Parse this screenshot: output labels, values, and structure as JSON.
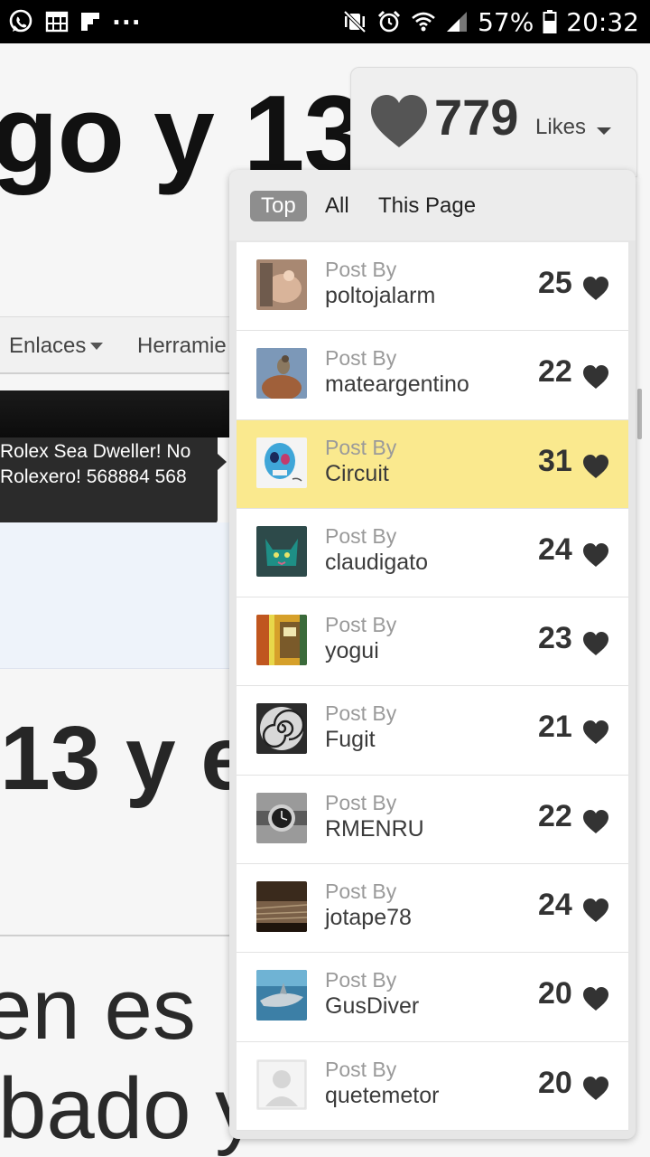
{
  "status_bar": {
    "left_icons": [
      "whatsapp-icon",
      "calendar-grid-icon",
      "flipboard-icon"
    ],
    "more": "...",
    "right_icons": [
      "mute-vibrate-icon",
      "alarm-icon",
      "wifi-icon",
      "signal-icon",
      "battery-icon"
    ],
    "battery": "57%",
    "time": "20:32",
    "colors": {
      "bar": "#000000",
      "icons": "#ffffff"
    }
  },
  "background_page": {
    "heading_top": "go y 13",
    "nav": {
      "item1": "Enlaces",
      "item2": "Herramie"
    },
    "tooltip": {
      "line1": "Rolex Sea Dweller! No",
      "line2": "Rolexero! 568884 568"
    },
    "heading_mid": "13 y e",
    "text_line1": "en es",
    "text_line2": "bado y"
  },
  "likes": {
    "count": "779",
    "label": "Likes",
    "heart_color": "#555555"
  },
  "tabs": [
    {
      "label": "Top",
      "active": true
    },
    {
      "label": "All",
      "active": false
    },
    {
      "label": "This Page",
      "active": false
    }
  ],
  "entries": [
    {
      "prefix": "Post By",
      "user": "poltojalarm",
      "count": "25",
      "avatar": "avatar-hand-icon"
    },
    {
      "prefix": "Post By",
      "user": "mateargentino",
      "count": "22",
      "avatar": "avatar-bird-icon"
    },
    {
      "prefix": "Post By",
      "user": "Circuit",
      "count": "31",
      "avatar": "avatar-skull-art-icon",
      "highlight": true
    },
    {
      "prefix": "Post By",
      "user": "claudigato",
      "count": "24",
      "avatar": "avatar-cat-icon"
    },
    {
      "prefix": "Post By",
      "user": "yogui",
      "count": "23",
      "avatar": "avatar-clock-art-icon"
    },
    {
      "prefix": "Post By",
      "user": "Fugit",
      "count": "21",
      "avatar": "avatar-spiral-clock-icon"
    },
    {
      "prefix": "Post By",
      "user": "RMENRU",
      "count": "22",
      "avatar": "avatar-watch-icon"
    },
    {
      "prefix": "Post By",
      "user": "jotape78",
      "count": "24",
      "avatar": "avatar-dark-scene-icon"
    },
    {
      "prefix": "Post By",
      "user": "GusDiver",
      "count": "20",
      "avatar": "avatar-shark-icon"
    },
    {
      "prefix": "Post By",
      "user": "quetemetor",
      "count": "20",
      "avatar": "avatar-default-user-icon"
    }
  ],
  "colors": {
    "highlight_row": "#fae98e",
    "active_tab": "#8e8e8e",
    "muted_text": "#9a9a9a",
    "heart": "#333333"
  }
}
